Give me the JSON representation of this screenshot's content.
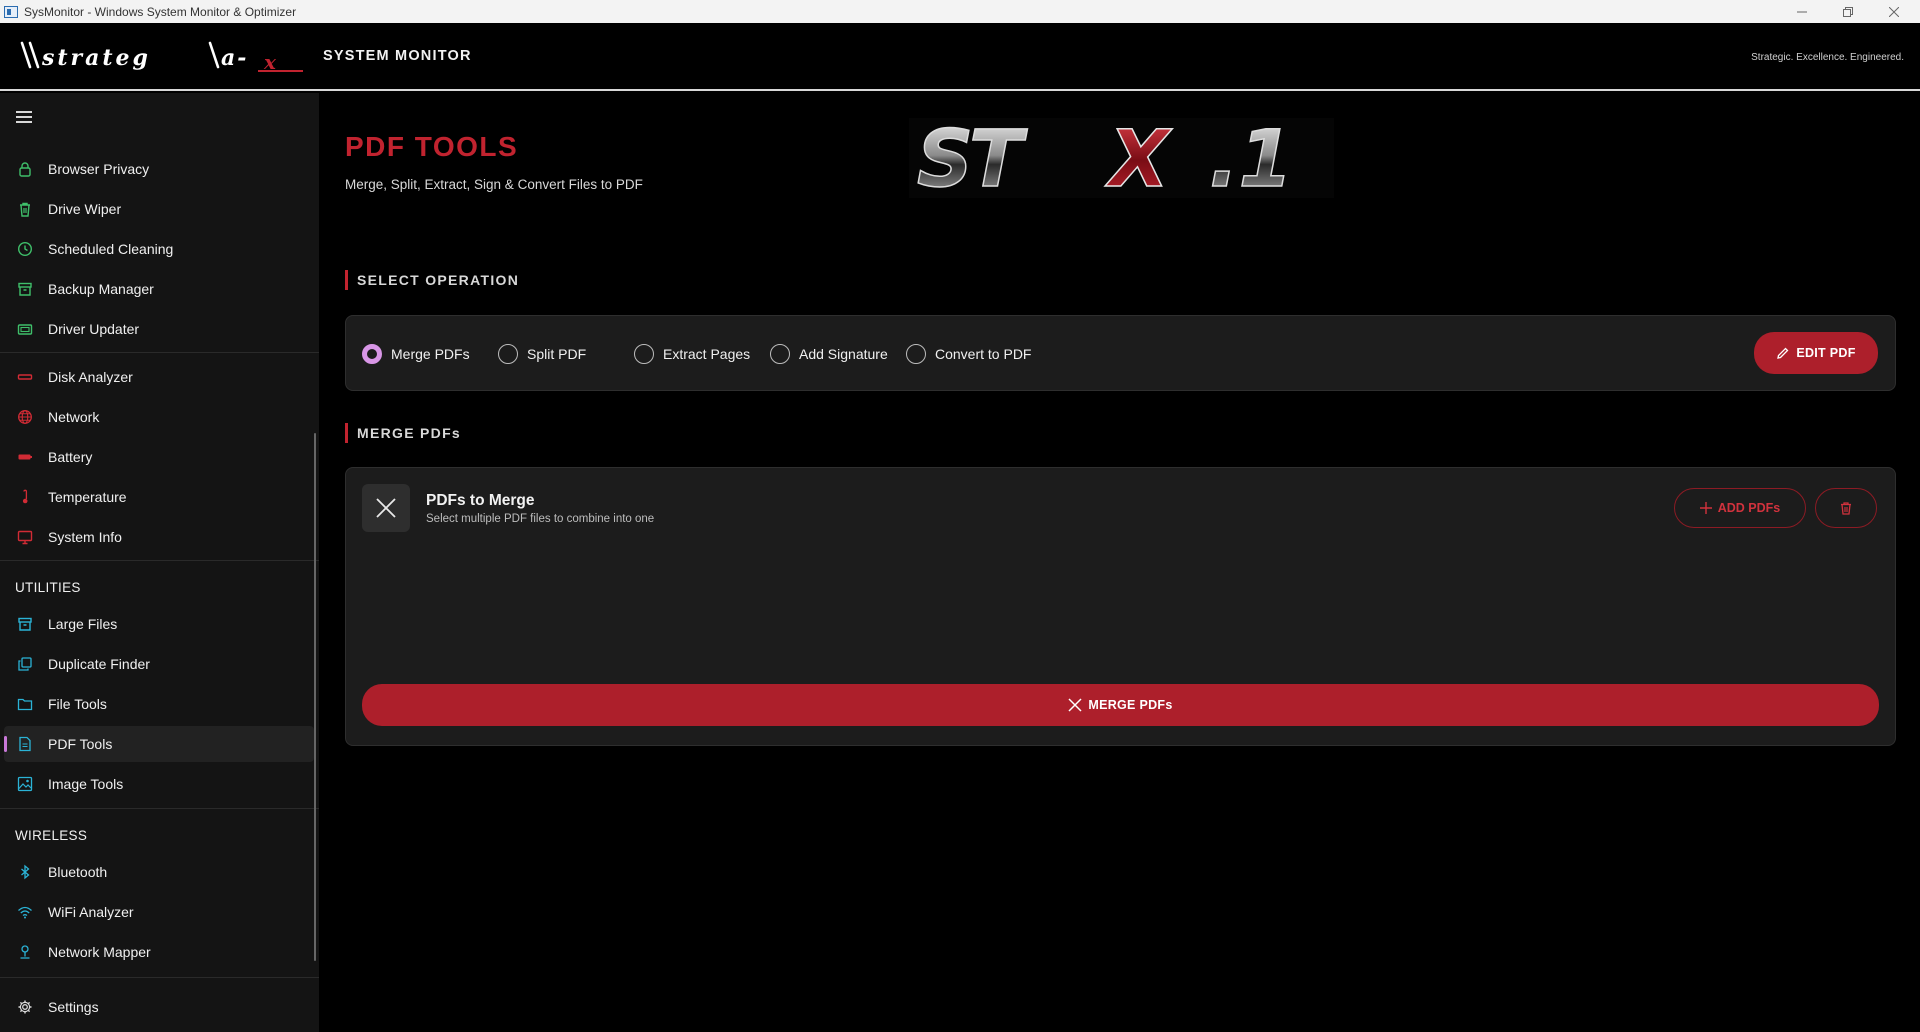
{
  "window": {
    "title": "SysMonitor - Windows System Monitor & Optimizer",
    "controls": {
      "minimize": "minimize-icon",
      "maximize": "restore-icon",
      "close": "close-icon"
    }
  },
  "header": {
    "logo_text": "\\\\strateg\\a-x",
    "app_name": "SYSTEM MONITOR",
    "tagline": "Strategic. Excellence. Engineered."
  },
  "colors": {
    "accent_red": "#c1232f",
    "button_red": "#ad1f2b",
    "active_indicator": "#c978d8",
    "radio_checked": "#d896e6",
    "icon_green": "#3fbf6a",
    "icon_red": "#d12b35",
    "icon_cyan": "#2bb3d6"
  },
  "sidebar": {
    "group1": [
      {
        "label": "Browser Privacy",
        "icon": "lock-icon"
      },
      {
        "label": "Drive Wiper",
        "icon": "trash-icon"
      },
      {
        "label": "Scheduled Cleaning",
        "icon": "clock-icon"
      },
      {
        "label": "Backup Manager",
        "icon": "archive-icon"
      },
      {
        "label": "Driver Updater",
        "icon": "chip-icon"
      }
    ],
    "group2": [
      {
        "label": "Disk Analyzer",
        "icon": "disk-icon"
      },
      {
        "label": "Network",
        "icon": "globe-icon"
      },
      {
        "label": "Battery",
        "icon": "battery-icon"
      },
      {
        "label": "Temperature",
        "icon": "thermometer-icon"
      },
      {
        "label": "System Info",
        "icon": "monitor-icon"
      }
    ],
    "utilities_title": "UTILITIES",
    "utilities": [
      {
        "label": "Large Files",
        "icon": "archive-icon"
      },
      {
        "label": "Duplicate Finder",
        "icon": "copy-icon"
      },
      {
        "label": "File Tools",
        "icon": "folder-icon"
      },
      {
        "label": "PDF Tools",
        "icon": "pdf-icon",
        "active": true
      },
      {
        "label": "Image Tools",
        "icon": "image-icon"
      }
    ],
    "wireless_title": "WIRELESS",
    "wireless": [
      {
        "label": "Bluetooth",
        "icon": "bluetooth-icon"
      },
      {
        "label": "WiFi Analyzer",
        "icon": "wifi-icon"
      },
      {
        "label": "Network Mapper",
        "icon": "pin-icon"
      }
    ],
    "settings": {
      "label": "Settings",
      "icon": "gear-icon"
    }
  },
  "main": {
    "title": "PDF TOOLS",
    "subtitle": "Merge, Split, Extract, Sign & Convert Files to PDF",
    "banner_text": "STX.1",
    "select_operation": {
      "heading": "SELECT OPERATION",
      "options": [
        "Merge PDFs",
        "Split PDF",
        "Extract Pages",
        "Add Signature",
        "Convert to PDF"
      ],
      "selected": "Merge PDFs",
      "edit_button": "EDIT PDF"
    },
    "merge": {
      "heading": "MERGE PDFs",
      "card_title": "PDFs to Merge",
      "card_subtitle": "Select multiple PDF files to combine into one",
      "add_button": "ADD PDFs",
      "clear_button_icon": "trash-icon",
      "action_button": "MERGE PDFs"
    }
  }
}
